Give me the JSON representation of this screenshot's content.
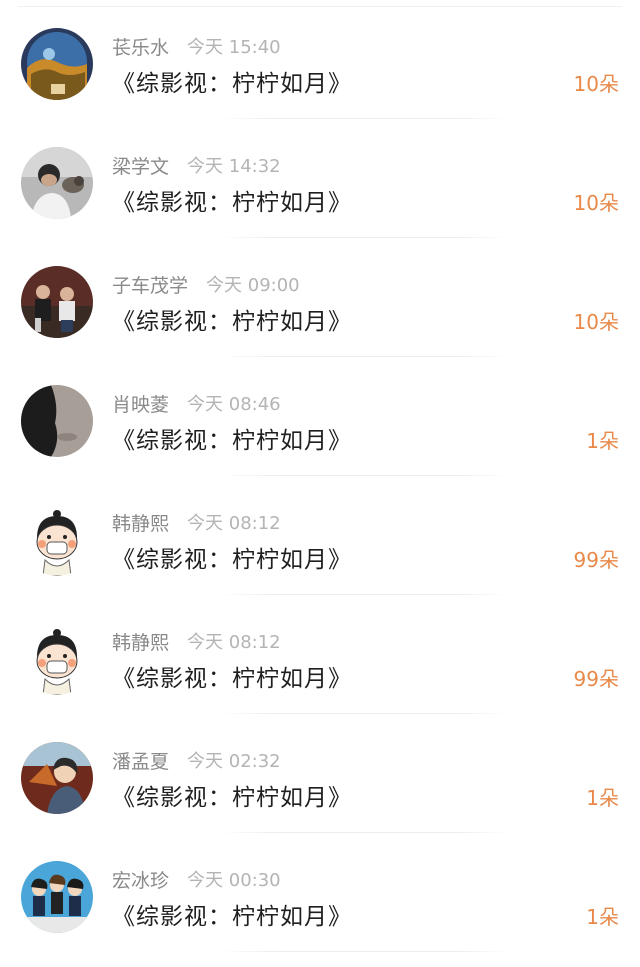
{
  "gifts": [
    {
      "name": "苌乐水",
      "time": "今天 15:40",
      "title": "《综影视：柠柠如月》",
      "amount": "10朵",
      "avatar": "globe-landscape-avatar"
    },
    {
      "name": "梁学文",
      "time": "今天 14:32",
      "title": "《综影视：柠柠如月》",
      "amount": "10朵",
      "avatar": "person-with-dog-avatar"
    },
    {
      "name": "子车茂学",
      "time": "今天 09:00",
      "title": "《综影视：柠柠如月》",
      "amount": "10朵",
      "avatar": "two-people-avatar"
    },
    {
      "name": "肖映菱",
      "time": "今天 08:46",
      "title": "《综影视：柠柠如月》",
      "amount": "1朵",
      "avatar": "dark-silhouette-avatar"
    },
    {
      "name": "韩静熙",
      "time": "今天 08:12",
      "title": "《综影视：柠柠如月》",
      "amount": "99朵",
      "avatar": "cartoon-girl-avatar"
    },
    {
      "name": "韩静熙",
      "time": "今天 08:12",
      "title": "《综影视：柠柠如月》",
      "amount": "99朵",
      "avatar": "cartoon-girl-avatar"
    },
    {
      "name": "潘孟夏",
      "time": "今天 02:32",
      "title": "《综影视：柠柠如月》",
      "amount": "1朵",
      "avatar": "anime-boy-avatar"
    },
    {
      "name": "宏冰珍",
      "time": "今天 00:30",
      "title": "《综影视：柠柠如月》",
      "amount": "1朵",
      "avatar": "anime-group-avatar"
    }
  ],
  "colors": {
    "amount": "#e8894a",
    "name": "#8a8a8a",
    "time": "#b4b4b4",
    "title": "#1f1f1f"
  }
}
